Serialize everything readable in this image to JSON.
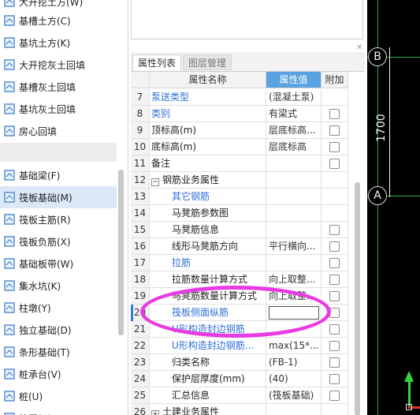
{
  "nav": {
    "items": [
      {
        "label": "大开挖土方(W)",
        "icon": "excavation-icon"
      },
      {
        "label": "基槽土方(C)",
        "icon": "trench-earthwork-icon"
      },
      {
        "label": "基坑土方(K)",
        "icon": "pit-earthwork-icon"
      },
      {
        "label": "大开挖灰土回填",
        "icon": "backfill-icon"
      },
      {
        "label": "基槽灰土回填",
        "icon": "backfill-icon"
      },
      {
        "label": "基坑灰土回填",
        "icon": "backfill-icon"
      },
      {
        "label": "房心回填",
        "icon": "room-backfill-icon"
      },
      {
        "label": "基础梁(F)",
        "icon": "foundation-beam-icon"
      },
      {
        "label": "筏板基础(M)",
        "icon": "raft-foundation-icon"
      },
      {
        "label": "筏板主筋(R)",
        "icon": "raft-main-rebar-icon"
      },
      {
        "label": "筏板负筋(X)",
        "icon": "raft-negative-rebar-icon"
      },
      {
        "label": "基础板带(W)",
        "icon": "foundation-strip-icon"
      },
      {
        "label": "集水坑(K)",
        "icon": "sump-icon"
      },
      {
        "label": "柱墩(Y)",
        "icon": "column-pier-icon"
      },
      {
        "label": "独立基础(D)",
        "icon": "isolated-footing-icon"
      },
      {
        "label": "条形基础(T)",
        "icon": "strip-footing-icon"
      },
      {
        "label": "桩承台(V)",
        "icon": "pile-cap-icon"
      },
      {
        "label": "桩(U)",
        "icon": "pile-icon"
      },
      {
        "label": "垫层(X)",
        "icon": "cushion-icon"
      }
    ],
    "selected_label": "筏板基础(M)"
  },
  "props": {
    "tabs": [
      "属性列表",
      "图层管理"
    ],
    "headers": {
      "name": "属性名称",
      "value": "属性值",
      "add": "附加"
    },
    "rows": [
      {
        "num": "7",
        "name": "泵送类型",
        "value": "(混凝土泵)",
        "blue": true,
        "checkbox": false
      },
      {
        "num": "8",
        "name": "类别",
        "value": "有梁式",
        "blue": true,
        "checkbox": true
      },
      {
        "num": "9",
        "name": "顶标高(m)",
        "value": "层底标高...",
        "blue": false,
        "checkbox": true
      },
      {
        "num": "10",
        "name": "底标高(m)",
        "value": "层底标高",
        "blue": false,
        "checkbox": true
      },
      {
        "num": "11",
        "name": "备注",
        "value": "",
        "blue": false,
        "checkbox": true
      },
      {
        "num": "12",
        "name": "钢筋业务属性",
        "value": "",
        "blue": false,
        "checkbox": false,
        "toggle": "−"
      },
      {
        "num": "13",
        "name": "其它钢筋",
        "value": "",
        "blue": true,
        "checkbox": false,
        "indent": true
      },
      {
        "num": "14",
        "name": "马凳筋参数图",
        "value": "",
        "blue": false,
        "checkbox": false,
        "indent": true
      },
      {
        "num": "15",
        "name": "马凳筋信息",
        "value": "",
        "blue": false,
        "checkbox": true,
        "indent": true
      },
      {
        "num": "16",
        "name": "线形马凳筋方向",
        "value": "平行横向...",
        "blue": false,
        "checkbox": true,
        "indent": true
      },
      {
        "num": "17",
        "name": "拉筋",
        "value": "",
        "blue": true,
        "checkbox": true,
        "indent": true
      },
      {
        "num": "18",
        "name": "拉筋数量计算方式",
        "value": "向上取整...",
        "blue": false,
        "checkbox": true,
        "indent": true
      },
      {
        "num": "19",
        "name": "马凳筋数量计算方式",
        "value": "向上取整...",
        "blue": false,
        "checkbox": true,
        "indent": true
      },
      {
        "num": "20",
        "name": "筏板侧面纵筋",
        "value": "",
        "blue": true,
        "checkbox": true,
        "indent": true,
        "editing": true
      },
      {
        "num": "21",
        "name": "U形构造封边钢筋",
        "value": "",
        "blue": true,
        "checkbox": true,
        "indent": true
      },
      {
        "num": "22",
        "name": "U形构造封边钢筋...",
        "value": "max(15*...",
        "blue": true,
        "checkbox": true,
        "indent": true
      },
      {
        "num": "23",
        "name": "归类名称",
        "value": "(FB-1)",
        "blue": false,
        "checkbox": true,
        "indent": true
      },
      {
        "num": "24",
        "name": "保护层厚度(mm)",
        "value": "(40)",
        "blue": false,
        "checkbox": true,
        "indent": true
      },
      {
        "num": "25",
        "name": "汇总信息",
        "value": "(筏板基础)",
        "blue": false,
        "checkbox": true,
        "indent": true
      },
      {
        "num": "26",
        "name": "土建业务属性",
        "value": "",
        "blue": false,
        "checkbox": false,
        "toggle": "+"
      }
    ]
  },
  "canvas": {
    "axis_top": "B",
    "axis_bottom": "A",
    "dimension": "1700",
    "line_color": "#2ea84a"
  },
  "colors": {
    "highlight": "#e83be3",
    "accent": "#5aa2e0",
    "link_blue": "#2f6fd6"
  }
}
